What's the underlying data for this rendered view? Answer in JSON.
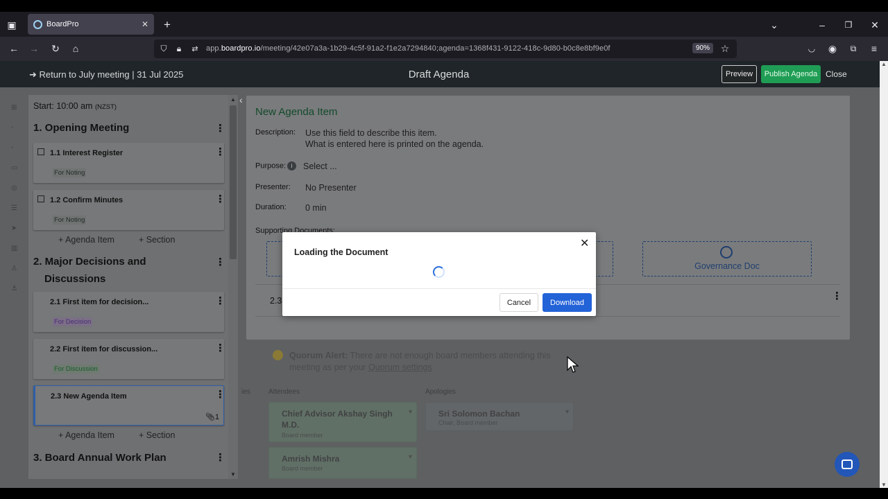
{
  "browser": {
    "tab_title": "BoardPro",
    "url_prefix": "app.",
    "url_domain": "boardpro.io",
    "url_rest": "/meeting/42e07a3a-1b29-4c5f-91a2-f1e2a7294840;agenda=1368f431-9122-418c-9d80-b0c8e8bf9e0f",
    "zoom": "90%"
  },
  "header": {
    "back_link": "Return to July meeting | 31 Jul 2025",
    "title": "Draft Agenda",
    "preview": "Preview",
    "publish": "Publish Agenda",
    "close": "Close"
  },
  "sidebar": {
    "start": "Start: 10:00 am",
    "timezone": "(NZST)",
    "sections": [
      {
        "title": "1. Opening Meeting"
      },
      {
        "title_line1": "2. Major Decisions and",
        "title_line2": "Discussions"
      },
      {
        "title": "3. Board Annual Work Plan"
      }
    ],
    "items": [
      {
        "title": "1.1 Interest Register",
        "badge": "For Noting"
      },
      {
        "title": "1.2 Confirm Minutes",
        "badge": "For Noting"
      },
      {
        "title": "2.1 First item for decision...",
        "badge": "For Decision"
      },
      {
        "title": "2.2 First item for discussion...",
        "badge": "For Discussion"
      },
      {
        "title": "2.3 New Agenda Item",
        "attachments": "1"
      }
    ],
    "add_agenda_item": "+ Agenda Item",
    "add_section": "+ Section"
  },
  "panel": {
    "title": "New Agenda Item",
    "description_label": "Description:",
    "description_line1": "Use this field to describe this item.",
    "description_line2": "What is entered here is printed on the agenda.",
    "purpose_label": "Purpose:",
    "purpose_value": "Select ...",
    "presenter_label": "Presenter:",
    "presenter_value": "No Presenter",
    "duration_label": "Duration:",
    "duration_value": "0 min",
    "supporting_docs_label": "Supporting Documents:",
    "governance_doc": "Governance Doc",
    "row_number": "2.3"
  },
  "background": {
    "quorum_bold": "Quorum Alert:",
    "quorum_text": "There are not enough board members attending this meeting as per your",
    "quorum_link": "Quorum settings",
    "attendees_label": "Attendees",
    "apologies_label": "Apologies",
    "attendees": [
      {
        "name_line1": "Chief Advisor Akshay Singh",
        "name_line2": "M.D.",
        "role": "Board member"
      },
      {
        "name_line1": "Amrish Mishra",
        "role": "Board member"
      }
    ],
    "apologies": [
      {
        "name": "Sri Solomon Bachan",
        "role": "Chair, Board member"
      }
    ]
  },
  "modal": {
    "title": "Loading the Document",
    "cancel": "Cancel",
    "download": "Download"
  },
  "colors": {
    "accent_green": "#1f9d55",
    "primary_blue": "#2363d8"
  }
}
